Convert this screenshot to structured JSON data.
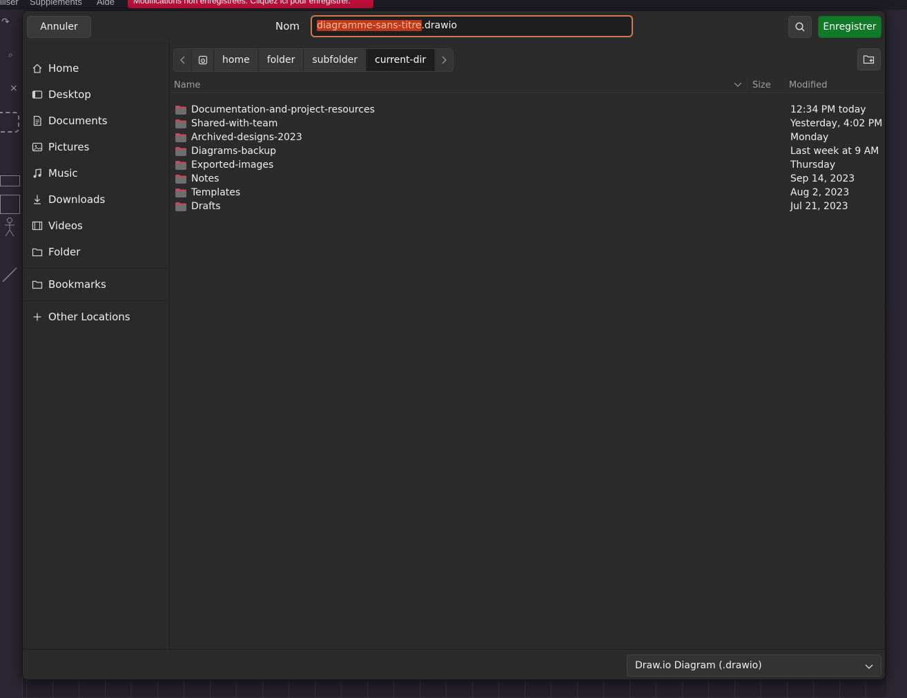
{
  "background_app": {
    "menu": [
      "iliser",
      "Suppléments",
      "Aide"
    ],
    "banner": "Modifications non enregistrées. Cliquez ici pour enregistrer."
  },
  "dialog": {
    "header": {
      "cancel_label": "Annuler",
      "name_label": "Nom",
      "filename_selected": "diagramme-sans-titre",
      "filename_rest": ".drawio",
      "save_label": "Enregistrer",
      "search_icon": "search-icon"
    },
    "sidebar": {
      "items": [
        {
          "label": "Home",
          "icon": "home-icon"
        },
        {
          "label": "Desktop",
          "icon": "desktop-icon"
        },
        {
          "label": "Documents",
          "icon": "documents-icon"
        },
        {
          "label": "Pictures",
          "icon": "pictures-icon"
        },
        {
          "label": "Music",
          "icon": "music-icon"
        },
        {
          "label": "Downloads",
          "icon": "downloads-icon"
        },
        {
          "label": "Videos",
          "icon": "videos-icon"
        },
        {
          "label": "Folder",
          "icon": "folder-icon"
        }
      ],
      "bookmark": {
        "label": "Bookmarks",
        "icon": "folder-icon"
      },
      "other_locations": {
        "label": "Other Locations",
        "icon": "plus-icon"
      }
    },
    "pathbar": {
      "root_icon": "disk-icon",
      "segments": [
        "home",
        "folder",
        "subfolder",
        "current-dir"
      ],
      "active_index": 3
    },
    "columns": {
      "name": "Name",
      "size": "Size",
      "modified": "Modified"
    },
    "files": [
      {
        "name": "Documentation-and-project-resources",
        "modified": "12:34 PM today"
      },
      {
        "name": "Shared-with-team",
        "modified": "Yesterday, 4:02 PM"
      },
      {
        "name": "Archived-designs-2023",
        "modified": "Monday"
      },
      {
        "name": "Diagrams-backup",
        "modified": "Last week at 9 AM"
      },
      {
        "name": "Exported-images",
        "modified": "Thursday"
      },
      {
        "name": "Notes",
        "modified": "Sep 14, 2023"
      },
      {
        "name": "Templates",
        "modified": "Aug 2, 2023"
      },
      {
        "name": "Drafts",
        "modified": "Jul 21, 2023"
      }
    ],
    "footer": {
      "filter_label": "Draw.io Diagram (.drawio)"
    },
    "colors": {
      "accent_save": "#117a28",
      "focus_border": "#d07a50",
      "selection": "#c0381a"
    }
  }
}
